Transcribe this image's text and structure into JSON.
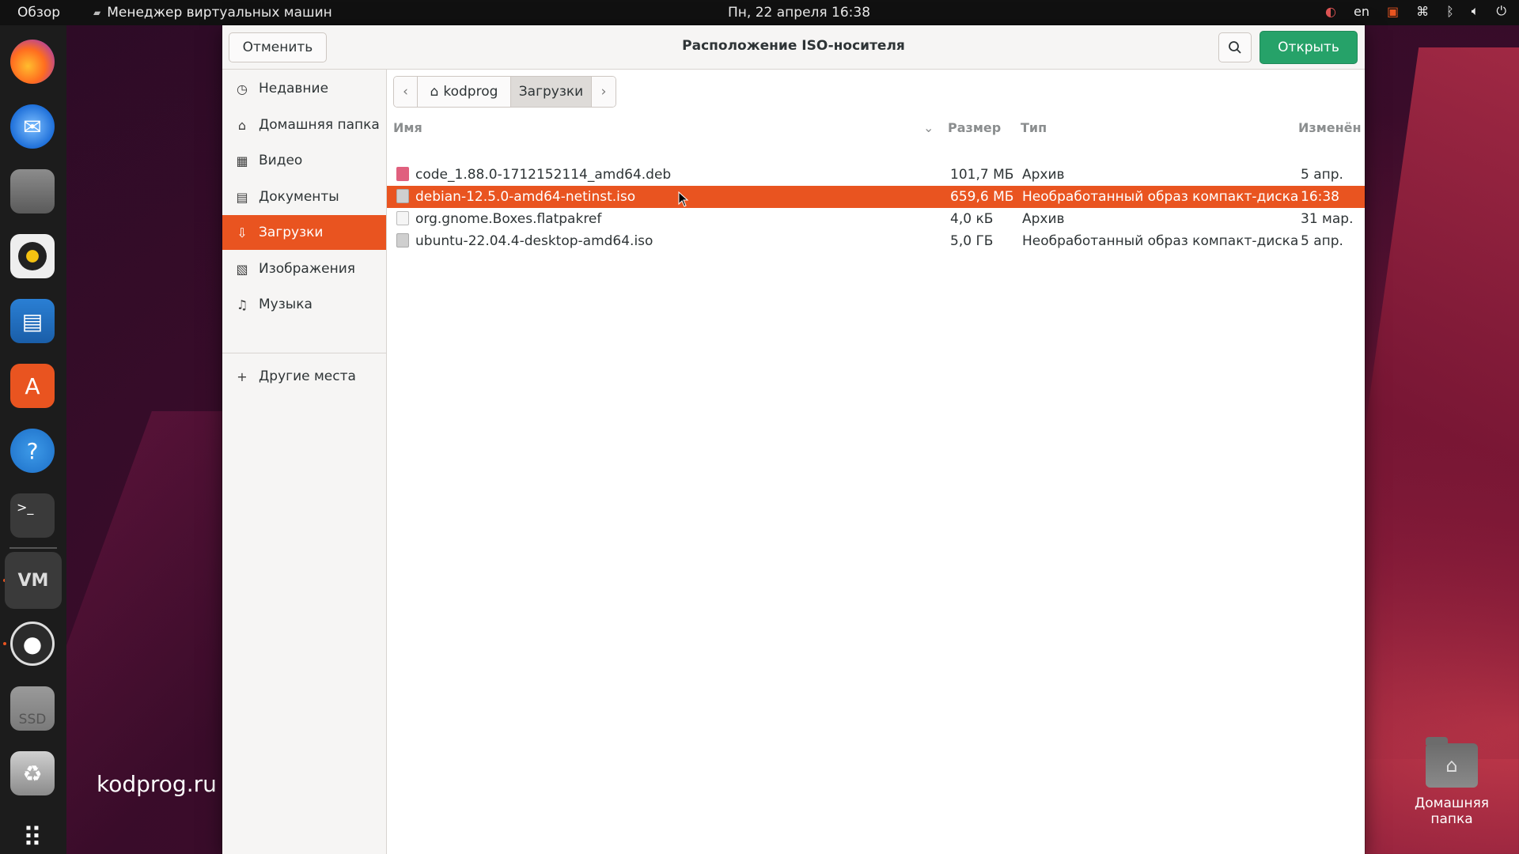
{
  "topbar": {
    "overview": "Обзор",
    "app_name": "Менеджер виртуальных машин",
    "clock": "Пн, 22 апреля  16:38",
    "lang": "en"
  },
  "dock": {
    "items": [
      "firefox-icon",
      "thunderbird-icon",
      "files-icon",
      "rhythmbox-icon",
      "writer-icon",
      "app-center-icon",
      "help-icon",
      "terminal-icon",
      "virt-manager-icon",
      "obs-icon",
      "ssd-icon",
      "trash-icon",
      "apps-grid-icon"
    ],
    "ssd_label": "SSD"
  },
  "desktop": {
    "watermark": "kodprog.ru",
    "home_label": "Домашняя папка"
  },
  "dialog": {
    "title": "Расположение ISO-носителя",
    "cancel_label": "Отменить",
    "open_label": "Открыть",
    "accent": "#e95420",
    "open_color": "#26a269"
  },
  "sidebar": {
    "items": [
      {
        "label": "Недавние",
        "icon": "clock-icon"
      },
      {
        "label": "Домашняя папка",
        "icon": "home-icon"
      },
      {
        "label": "Видео",
        "icon": "film-icon"
      },
      {
        "label": "Документы",
        "icon": "document-icon"
      },
      {
        "label": "Загрузки",
        "icon": "download-icon"
      },
      {
        "label": "Изображения",
        "icon": "image-icon"
      },
      {
        "label": "Музыка",
        "icon": "music-icon"
      }
    ],
    "other": "Другие места"
  },
  "path": {
    "home": "kodprog",
    "current": "Загрузки"
  },
  "columns": {
    "name": "Имя",
    "size": "Размер",
    "type": "Тип",
    "modified": "Изменён"
  },
  "files": [
    {
      "name": "code_1.88.0-1712152114_amd64.deb",
      "size": "101,7 МБ",
      "type": "Архив",
      "modified": "5 апр.",
      "icon_color": "#e0607e"
    },
    {
      "name": "debian-12.5.0-amd64-netinst.iso",
      "size": "659,6 МБ",
      "type": "Необработанный образ компакт-диска",
      "modified": "16:38",
      "icon_color": "#cfcfcf"
    },
    {
      "name": "org.gnome.Boxes.flatpakref",
      "size": "4,0 кБ",
      "type": "Архив",
      "modified": "31 мар.",
      "icon_color": "#f0f0f0"
    },
    {
      "name": "ubuntu-22.04.4-desktop-amd64.iso",
      "size": "5,0 ГБ",
      "type": "Необработанный образ компакт-диска",
      "modified": "5 апр.",
      "icon_color": "#cfcfcf"
    }
  ]
}
